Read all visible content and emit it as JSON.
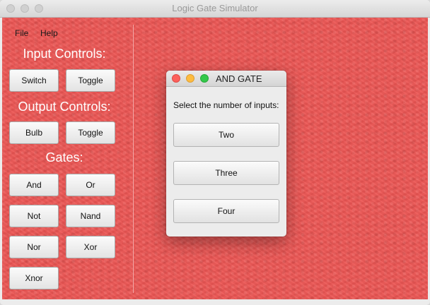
{
  "window": {
    "title": "Logic Gate Simulator"
  },
  "menu": {
    "file": "File",
    "help": "Help"
  },
  "sidebar": {
    "input_heading": "Input Controls:",
    "input_buttons": [
      "Switch",
      "Toggle"
    ],
    "output_heading": "Output Controls:",
    "output_buttons": [
      "Bulb",
      "Toggle"
    ],
    "gates_heading": "Gates:",
    "gate_buttons": [
      "And",
      "Or",
      "Not",
      "Nand",
      "Nor",
      "Xor",
      "Xnor"
    ]
  },
  "dialog": {
    "title": "AND GATE",
    "prompt": "Select the number of inputs:",
    "options": [
      "Two",
      "Three",
      "Four"
    ]
  },
  "colors": {
    "canvas": "#ec5654",
    "close": "#fc605b",
    "minimize": "#fdbc40",
    "maximize": "#34c84a"
  }
}
